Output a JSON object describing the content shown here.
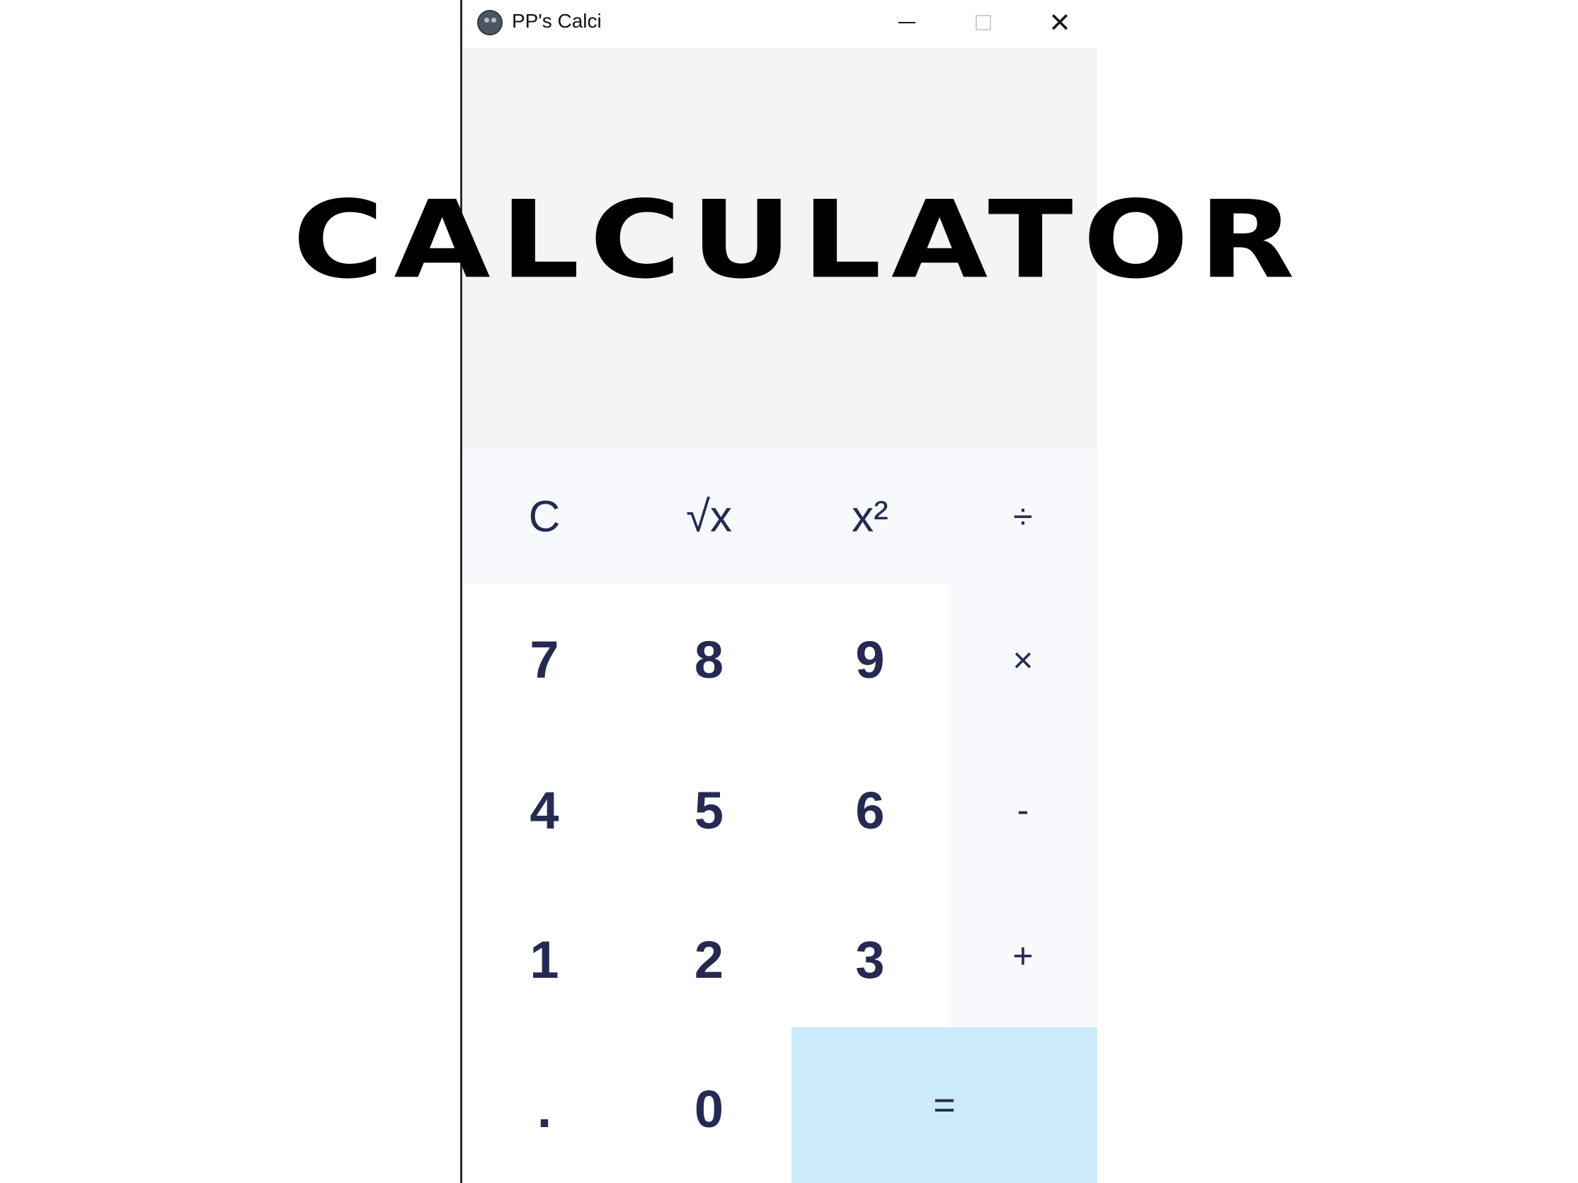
{
  "window": {
    "title": "PP's Calci",
    "icon": "app-icon",
    "controls": {
      "minimize": "minimize-icon",
      "maximize": "maximize-icon",
      "close": "close-icon",
      "close_glyph": "✕"
    }
  },
  "display": {
    "value": ""
  },
  "overlay": {
    "title": "CALCULATOR"
  },
  "keys": {
    "clear": "C",
    "sqrt": "√x",
    "square": "x²",
    "divide": "÷",
    "seven": "7",
    "eight": "8",
    "nine": "9",
    "multiply": "×",
    "four": "4",
    "five": "5",
    "six": "6",
    "subtract": "-",
    "one": "1",
    "two": "2",
    "three": "3",
    "add": "+",
    "decimal": ".",
    "zero": "0",
    "equals": "="
  },
  "colors": {
    "display_bg": "#f4f4f4",
    "function_key_bg": "#f8f9fd",
    "digit_key_bg": "#ffffff",
    "equals_bg": "#cbeafc",
    "key_text": "#262a52"
  }
}
